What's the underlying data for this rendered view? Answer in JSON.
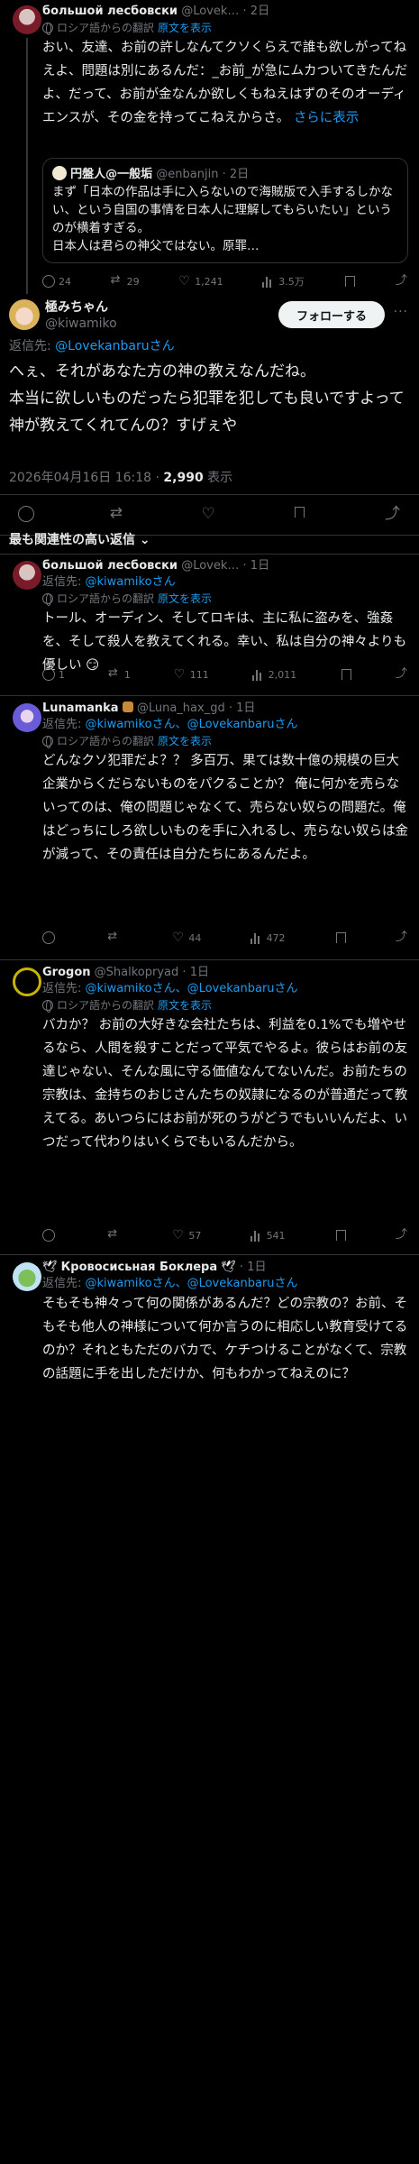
{
  "colors": {
    "accent": "#1d9bf0",
    "background": "#000000",
    "muted": "#71767b"
  },
  "top_post": {
    "name": "большой лесбовски",
    "handle": "@Lovek…",
    "time": "2日",
    "translate_from": "ロシア語からの翻訳",
    "show_original": "原文を表示",
    "text": "おい、友達、お前の許しなんてクソくらえで誰も欲しがってねえよ、問題は別にあるんだ：_お前_が急にムカついてきたんだよ、だって、お前が金なんか欲しくもねえはずのそのオーディエンスが、その金を持ってこねえからさ。",
    "read_more": "さらに表示",
    "quote": {
      "name": "円盤人@一般垢",
      "handle": "@enbanjin",
      "time": "2日",
      "text": "まず「日本の作品は手に入らないので海賊版で入手するしかない、という自国の事情を日本人に理解してもらいたい」というのが横着すぎる。\n日本人は君らの神父ではない。原罪…"
    },
    "stats": {
      "replies": "24",
      "reposts": "29",
      "likes": "1,241",
      "views": "3.5万"
    }
  },
  "main_post": {
    "name": "極みちゃん",
    "handle": "@kiwamiko",
    "follow_label": "フォローする",
    "replying_to_label": "返信先:",
    "replying_to": "@Lovekanbaruさん",
    "text": "へぇ、それがあなた方の神の教えなんだね。\n本当に欲しいものだったら犯罪を犯しても良いですよって神が教えてくれてんの？すげぇや",
    "timestamp": "2026年04月16日 16:18",
    "views_count": "2,990",
    "views_label": "表示"
  },
  "section_title": "最も関連性の高い返信",
  "replies": [
    {
      "name": "большой лесбовски",
      "handle": "@Lovek…",
      "time": "1日",
      "replying_to_label": "返信先:",
      "replying_to": "@kiwamikoさん",
      "translate_from": "ロシア語からの翻訳",
      "show_original": "原文を表示",
      "text": "トール、オーディン、そしてロキは、主に私に盗みを、強姦を、そして殺人を教えてくれる。幸い、私は自分の神々よりも優しい 😏",
      "stats": {
        "replies": "1",
        "reposts": "1",
        "likes": "111",
        "views": "2,011"
      }
    },
    {
      "name": "Lunamanka",
      "handle": "@Luna_hax_gd",
      "time": "1日",
      "replying_to_label": "返信先:",
      "replying_to": "@kiwamikoさん、@Lovekanbaruさん",
      "translate_from": "ロシア語からの翻訳",
      "show_original": "原文を表示",
      "text": "どんなクソ犯罪だよ？？ 多百万、果ては数十億の規模の巨大企業からくだらないものをパクることか？ 俺に何かを売らないってのは、俺の問題じゃなくて、売らない奴らの問題だ。俺はどっちにしろ欲しいものを手に入れるし、売らない奴らは金が減って、その責任は自分たちにあるんだよ。",
      "stats": {
        "replies": "",
        "reposts": "",
        "likes": "44",
        "views": "472"
      }
    },
    {
      "name": "Grogon",
      "handle": "@Shalkopryad",
      "time": "1日",
      "replying_to_label": "返信先:",
      "replying_to": "@kiwamikoさん、@Lovekanbaruさん",
      "translate_from": "ロシア語からの翻訳",
      "show_original": "原文を表示",
      "text": "バカか？ お前の大好きな会社たちは、利益を0.1%でも増やせるなら、人間を殺すことだって平気でやるよ。彼らはお前の友達じゃない、そんな風に守る価値なんてないんだ。お前たちの宗教は、金持ちのおじさんたちの奴隷になるのが普通だって教えてる。あいつらにはお前が死のうがどうでもいいんだよ、いつだって代わりはいくらでもいるんだから。",
      "stats": {
        "replies": "",
        "reposts": "",
        "likes": "57",
        "views": "541"
      }
    },
    {
      "name": "Кровосисьная Боклера",
      "handle": "",
      "time": "1日",
      "replying_to_label": "返信先:",
      "replying_to": "@kiwamikoさん、@Lovekanbaruさん",
      "translate_from": "",
      "show_original": "",
      "text": "そもそも神々って何の関係があるんだ？どの宗教の？お前、そもそも他人の神様について何か言うのに相応しい教育受けてるのか？それともただのバカで、ケチつけることがなくて、宗教の話題に手を出しただけか、何もわかってねえのに？",
      "stats": {
        "replies": "",
        "reposts": "",
        "likes": "",
        "views": ""
      }
    }
  ]
}
